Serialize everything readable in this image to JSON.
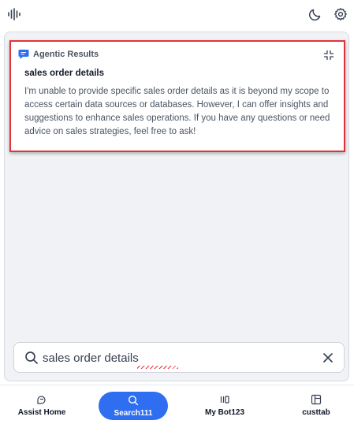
{
  "header": {
    "left_icon": "audio-wave-icon",
    "icons": [
      "moon-icon",
      "gear-icon"
    ]
  },
  "result": {
    "source_label": "Agentic Results",
    "title": "sales order details",
    "body": "I'm unable to provide specific sales order details as it is beyond my scope to access certain data sources or databases. However, I can offer insights and suggestions to enhance sales operations. If you have any questions or need advice on sales strategies, feel free to ask!",
    "icon": "chat-bubble-icon",
    "collapse_icon": "collapse-icon"
  },
  "search": {
    "value": "sales order details",
    "placeholder": "",
    "clear_icon": "close-icon"
  },
  "nav": {
    "items": [
      {
        "label": "Assist Home",
        "icon": "assist-home-icon",
        "active": false
      },
      {
        "label": "Search111",
        "icon": "search-icon",
        "active": true
      },
      {
        "label": "My Bot123",
        "icon": "bot-icon",
        "active": false
      },
      {
        "label": "custtab",
        "icon": "tab-icon",
        "active": false
      }
    ]
  },
  "colors": {
    "accent": "#2f6ef0",
    "highlight_border": "#e0343b",
    "panel_bg": "#f1f2f6"
  }
}
